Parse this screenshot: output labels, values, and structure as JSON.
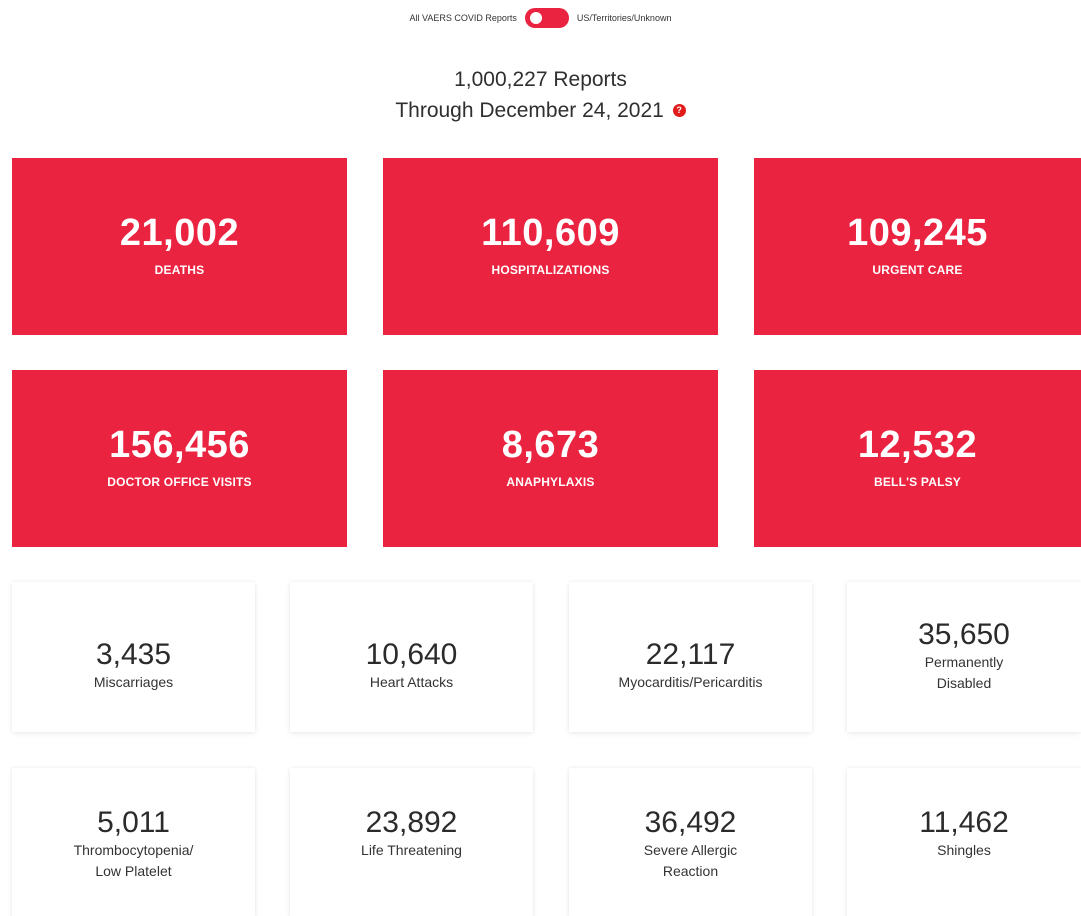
{
  "toggle": {
    "left_label": "All VAERS COVID Reports",
    "right_label": "US/Territories/Unknown"
  },
  "header": {
    "reports_line": "1,000,227 Reports",
    "through_line": "Through December 24, 2021",
    "help_glyph": "?"
  },
  "red_tiles": [
    {
      "value": "21,002",
      "label": "DEATHS"
    },
    {
      "value": "110,609",
      "label": "HOSPITALIZATIONS"
    },
    {
      "value": "109,245",
      "label": "URGENT CARE"
    },
    {
      "value": "156,456",
      "label": "DOCTOR OFFICE VISITS"
    },
    {
      "value": "8,673",
      "label": "ANAPHYLAXIS"
    },
    {
      "value": "12,532",
      "label": "BELL'S PALSY"
    }
  ],
  "cards": [
    {
      "value": "3,435",
      "label": "Miscarriages"
    },
    {
      "value": "10,640",
      "label": "Heart Attacks"
    },
    {
      "value": "22,117",
      "label": "Myocarditis/Pericarditis"
    },
    {
      "value": "35,650",
      "label": "Permanently\nDisabled"
    },
    {
      "value": "5,011",
      "label": "Thrombocytopenia/\nLow Platelet"
    },
    {
      "value": "23,892",
      "label": "Life Threatening"
    },
    {
      "value": "36,492",
      "label": "Severe Allergic\nReaction"
    },
    {
      "value": "11,462",
      "label": "Shingles"
    }
  ],
  "colors": {
    "accent": "#ea2340",
    "help_icon": "#e21b1b"
  },
  "icons": {
    "help": "question-circle-icon"
  }
}
